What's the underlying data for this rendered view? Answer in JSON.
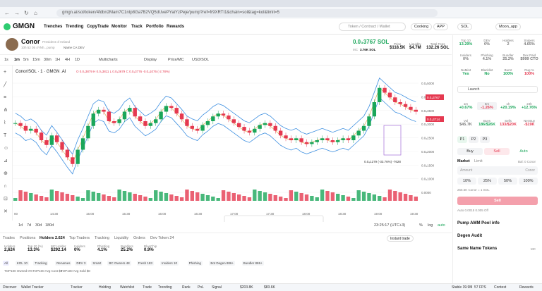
{
  "browser": {
    "url": "gmgn.ai/sol/token/4fdbn2Mam7C1ntp8Ga7B2VQ5dUvePYaiYzPeje/pump?ref=fr9XRTI1&chain=sol&tag=kol&limit=5"
  },
  "nav": {
    "brand": "GMGN",
    "items": [
      "Trenches",
      "Trending",
      "CopyTrade",
      "Monitor",
      "Track",
      "Portfolio",
      "Rewards"
    ],
    "search_placeholder": "Token / Contract / Wallet",
    "cooking": "Cooking",
    "app": "APP",
    "chain": "SOL",
    "user": "Moon_app"
  },
  "token": {
    "name": "Conor",
    "subtitle": "President of Ireland",
    "age": "10h 52 05  4YNh...pump",
    "links": "Name  CA  DEV",
    "price": "0.0₃3767 SOL",
    "mc_label": "MC",
    "mc": "3.76K SOL",
    "price_usd_label": "Price",
    "price_usd": "$118.5K",
    "liq_label": "Liquidity",
    "liq": "$4.7M",
    "supply_label": "Total Fees",
    "supply": "132.26 SOL"
  },
  "chart_toolbar": {
    "intervals": [
      "1s",
      "1m",
      "5m",
      "15m",
      "30m",
      "1H",
      "4H",
      "1D"
    ],
    "multicharts": "Multicharts",
    "display": "Display",
    "price_mc": "Price/MC",
    "usd_sol": "USD/SOL"
  },
  "chart": {
    "symbol": "Conor/SOL · 1 · GMGN .AI",
    "ohlc": "O 0.0₄3879 H 0.0₄3811 L 0.0₄3679 C 0.0₄3776 -0.0₄1076 (-2.78%)",
    "yticks": [
      "0.0₄5000",
      "0.0₄4000",
      "0.0₄3500",
      "0.0₄3000",
      "0.0₄2500",
      "0.0₄2000",
      "0.0₄1500",
      "0.0₄1000",
      "0.0000"
    ],
    "xticks": [
      "00",
      "14:30",
      "15:00",
      "15:30",
      "16:00",
      "16:30",
      "17:00",
      "17:30",
      "18:00",
      "18:30",
      "19:00",
      "19:30"
    ],
    "annotation": "0.0₄1279 (-33.76%) -7628",
    "price_tag": "0.0₄3767",
    "sub_label": "0.0₄3714"
  },
  "range_buttons": [
    "1d",
    "7d",
    "30d",
    "180d"
  ],
  "time": "23:25:17 (UTC+3)",
  "scale": [
    "%",
    "log",
    "auto"
  ],
  "trades_tabs": [
    "Trades",
    "Positions",
    "Holders 2.624",
    "Top Traders",
    "Tracking",
    "Liquidity",
    "Orders",
    "Dev Token 24"
  ],
  "instant_trade": "Instant trade",
  "holder_stats": [
    {
      "label": "Holders",
      "value": "2,624"
    },
    {
      "label": "Top 10 (%)",
      "value": "13.3%"
    },
    {
      "label": "MC Holder",
      "value": "$292.14"
    },
    {
      "label": "Insiders",
      "value": "0%"
    },
    {
      "label": "Phishing",
      "value": "4.1%"
    },
    {
      "label": "Bundlers",
      "value": "25.2%"
    },
    {
      "label": "BlueChip",
      "value": "0.9%"
    }
  ],
  "filter_tabs": [
    "All",
    "KOL 10",
    "Tracking",
    "Renames",
    "DEV 3",
    "Smart",
    "BC Owners 48",
    "Fresh 183",
    "Insiders 10",
    "Phishing",
    "Bot Degen 886+",
    "Bundler 886+"
  ],
  "filter_sub": [
    "TOP100 Owned 0%",
    "TOP100 Avg Cost $0",
    "TOP100 Avg Sold $0"
  ],
  "status_bar": [
    "Discover",
    "Wallet Tracker",
    "Tracker",
    "Holding",
    "Watchlist",
    "Trade",
    "Trending",
    "Rank",
    "PnL",
    "Signal",
    "$203.8K",
    "$83.6K",
    "Stable 39.9M",
    "57 FPS",
    "Contest",
    "Rewards"
  ],
  "right_panel": {
    "stats": [
      {
        "label": "Top 10",
        "value": "13.29%",
        "cls": "green"
      },
      {
        "label": "DEV",
        "value": "0%",
        "cls": ""
      },
      {
        "label": "Holders",
        "value": "2",
        "cls": ""
      },
      {
        "label": "Snipers",
        "value": "4.65%",
        "cls": ""
      },
      {
        "label": "Insiders",
        "value": "0%",
        "cls": ""
      },
      {
        "label": "Phishing",
        "value": "4.1%",
        "cls": ""
      },
      {
        "label": "Bundler",
        "value": "25.2%",
        "cls": ""
      },
      {
        "label": "Dex Paid",
        "value": "$999 CTO",
        "cls": ""
      },
      {
        "label": "NoMint",
        "value": "Yes",
        "cls": "green"
      },
      {
        "label": "Blacklist",
        "value": "No",
        "cls": "green"
      },
      {
        "label": "Burnt",
        "value": "100%",
        "cls": "green"
      },
      {
        "label": "Rug %",
        "value": "100%",
        "cls": "red"
      }
    ],
    "launch": "Launch",
    "periods": [
      {
        "label": "1m",
        "value": "+0.67%",
        "cls": "green"
      },
      {
        "label": "5m",
        "value": "-1.26%",
        "cls": "red"
      },
      {
        "label": "1h",
        "value": "+20.19%",
        "cls": "green"
      },
      {
        "label": "24h",
        "value": "+12.76%",
        "cls": "green"
      }
    ],
    "vol": [
      {
        "label": "Vol",
        "value": "$45.7K"
      },
      {
        "label": "Buys",
        "value": "186/$26K"
      },
      {
        "label": "Sells",
        "value": "133/$20K"
      },
      {
        "label": "Net Buy",
        "value": "-$19K"
      }
    ],
    "presets": [
      "P1",
      "P2",
      "P3"
    ],
    "buy": "Buy",
    "sell": "Sell",
    "auto": "Auto",
    "market": "Market",
    "limit": "Limit",
    "bal": "Bal: 0 Conor",
    "amount": "Amount",
    "token": "Conor",
    "pcts": [
      "10%",
      "25%",
      "50%",
      "100%"
    ],
    "receive": "265.5K Conor = 1 SOL",
    "sell_btn": "Sell",
    "auto_row": "Auto  0.0015  0.005  Off",
    "pool": "Pump AMM Pool info",
    "audit": "Degen Audit",
    "same": "Same Name Tokens",
    "mc_label": "MC"
  }
}
